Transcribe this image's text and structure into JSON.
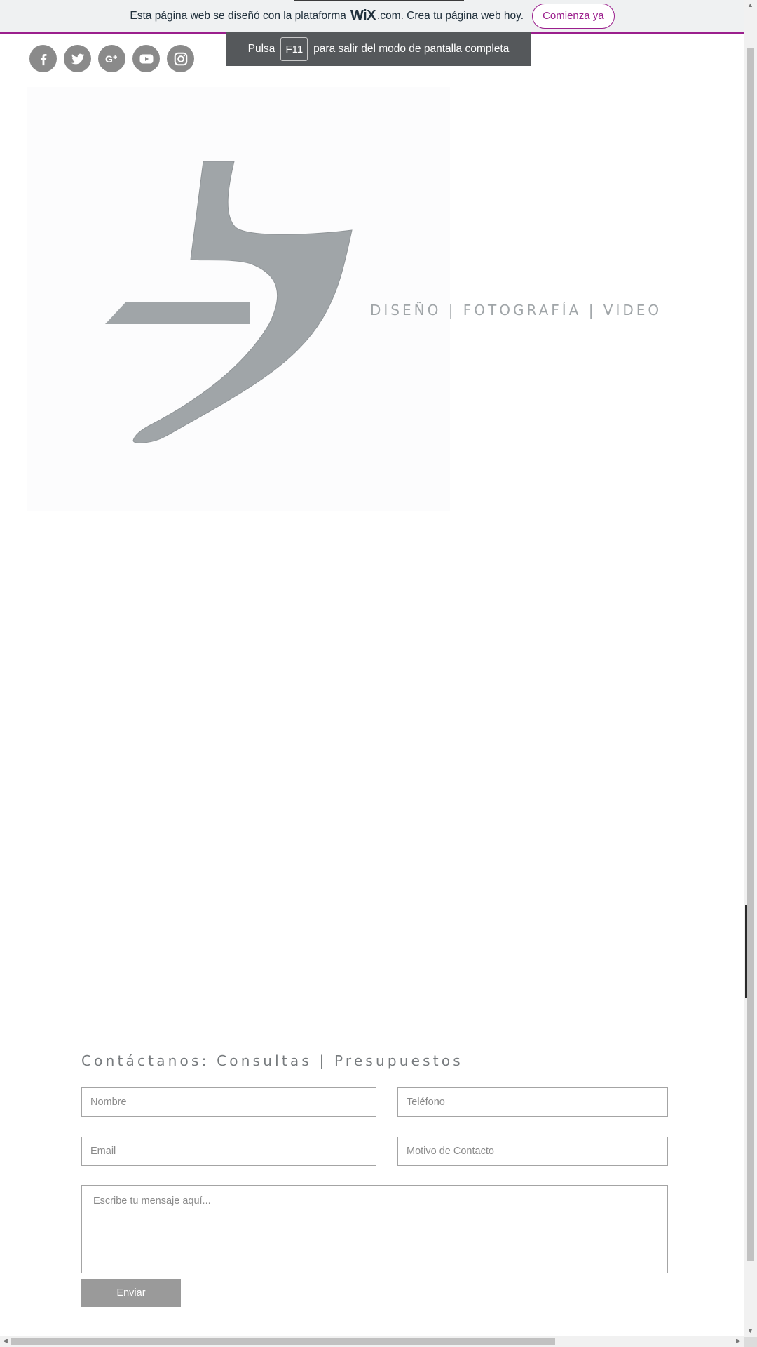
{
  "banner": {
    "text_before": "Esta página web se diseñó con la plataforma",
    "logo": "WiX",
    "text_after": ".com. Crea tu página web hoy.",
    "cta_label": "Comienza ya",
    "accent_color": "#9b1f8d"
  },
  "fullscreen_toast": {
    "prefix": "Pulsa",
    "key": "F11",
    "suffix": "para salir del modo de pantalla completa"
  },
  "social": {
    "icons": [
      "facebook-icon",
      "twitter-icon",
      "google-plus-icon",
      "youtube-icon",
      "instagram-icon"
    ],
    "color": "#8a8a8a"
  },
  "hero": {
    "tagline": "DISEÑO | FOTOGRAFÍA | VIDEO",
    "logo_color": "#a0a5a8"
  },
  "contact": {
    "title": "Contáctanos: Consultas | Presupuestos",
    "fields": {
      "name_placeholder": "Nombre",
      "phone_placeholder": "Teléfono",
      "email_placeholder": "Email",
      "reason_placeholder": "Motivo de Contacto",
      "message_placeholder": "Escribe tu mensaje aquí..."
    },
    "submit_label": "Enviar"
  }
}
